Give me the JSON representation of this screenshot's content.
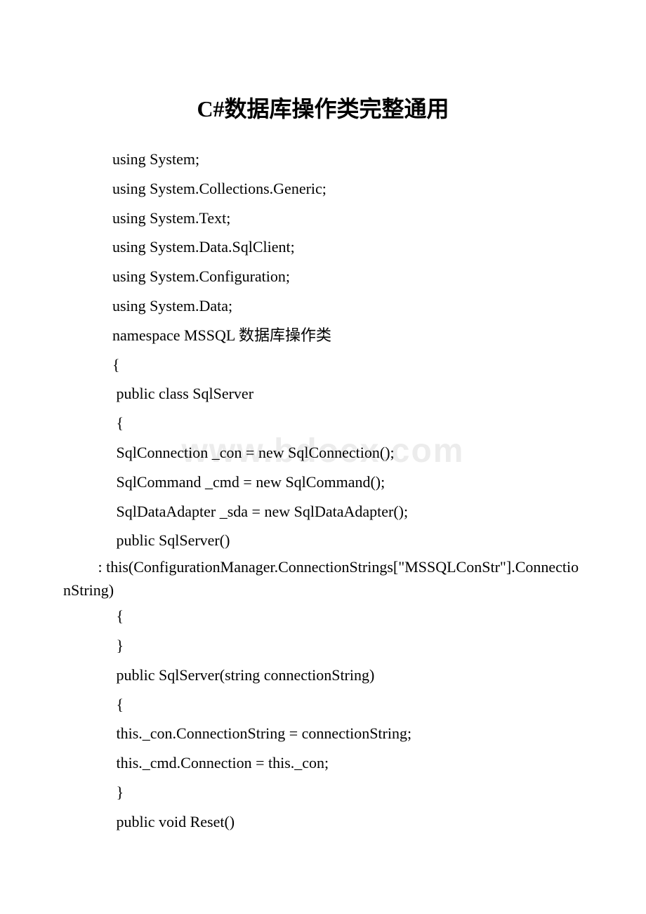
{
  "title": "C#数据库操作类完整通用",
  "watermark": "www.bdocx.com",
  "lines": [
    {
      "text": "using System;",
      "indent": true
    },
    {
      "text": "using System.Collections.Generic;",
      "indent": true
    },
    {
      "text": "using System.Text;",
      "indent": true
    },
    {
      "text": "using System.Data.SqlClient;",
      "indent": true
    },
    {
      "text": "using System.Configuration;",
      "indent": true
    },
    {
      "text": "using System.Data;",
      "indent": true
    },
    {
      "text": "namespace MSSQL 数据库操作类",
      "indent": true
    },
    {
      "text": "{",
      "indent": true
    },
    {
      "text": " public class SqlServer",
      "indent": true
    },
    {
      "text": " {",
      "indent": true
    },
    {
      "text": " SqlConnection _con = new SqlConnection();",
      "indent": true
    },
    {
      "text": " SqlCommand _cmd = new SqlCommand();",
      "indent": true
    },
    {
      "text": " SqlDataAdapter _sda = new SqlDataAdapter();",
      "indent": true
    },
    {
      "text": " public SqlServer()",
      "indent": true
    },
    {
      "text": "         : this(ConfigurationManager.ConnectionStrings[\"MSSQLConStr\"].ConnectionString)",
      "indent": false
    },
    {
      "text": " {",
      "indent": true
    },
    {
      "text": " }",
      "indent": true
    },
    {
      "text": " public SqlServer(string connectionString)",
      "indent": true
    },
    {
      "text": " {",
      "indent": true
    },
    {
      "text": " this._con.ConnectionString = connectionString;",
      "indent": true
    },
    {
      "text": " this._cmd.Connection = this._con;",
      "indent": true
    },
    {
      "text": " }",
      "indent": true
    },
    {
      "text": " public void Reset()",
      "indent": true
    }
  ]
}
